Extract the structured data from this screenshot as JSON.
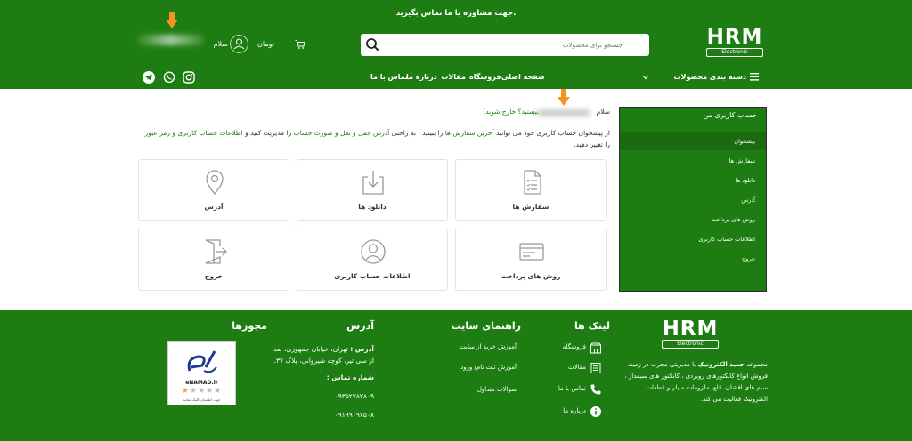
{
  "header": {
    "top_message": "جهت مشاوره با ما تماس بگیرید.",
    "logo_text": "HRM",
    "logo_sub": "Electronic",
    "search_placeholder": "جستجو برای محصولات",
    "cart_amount": "۰ تومان",
    "cart_count": "۰",
    "hello": "سلام"
  },
  "nav": {
    "categories": "دسته بندی محصولات",
    "items": [
      "صفحه اصلی",
      "فروشگاه",
      "مقالات",
      "درباره ما",
      "تماس با ما"
    ]
  },
  "account": {
    "welcome_prefix": "سلام",
    "welcome_suffix": "نیستید؟ خارج شوید)",
    "welcome_paren_open": "(",
    "intro_1": "از پیشخوان حساب کاربری خود می توانید",
    "intro_link_orders": "آخرین سفارش ها",
    "intro_2": "را ببینید ، به راحتی",
    "intro_link_address": "آدرس حمل و نقل و صورت حساب",
    "intro_3": "را مدیریت کنید و",
    "intro_link_account": "اطلاعات حساب کاربری و رمز عبور",
    "intro_4": "را تغییر دهید.",
    "cards": [
      "سفارش ها",
      "دانلود ها",
      "آدرس",
      "روش های پرداخت",
      "اطلاعات حساب کاربری",
      "خروج"
    ]
  },
  "sidebar": {
    "title": "حساب کاربری من",
    "items": [
      "پیشخوان",
      "سفارش ها",
      "دانلود ها",
      "آدرس",
      "روش های پرداخت",
      "اطلاعات حساب کاربری",
      "خروج"
    ]
  },
  "footer": {
    "about_prefix": "مجموعه",
    "about_brand": "حمید الکترونیک",
    "about_text": "با مدیریتی مجرب در زمینه فروش انواع کانکتورهای روبردی ، کانکتور های سیمدار ، سیم های افشان، قلع، ملزومات مایلر و قطعات الکترونیک فعالیت می کند.",
    "links_title": "لینک ها",
    "links": [
      "فروشگاه",
      "مقالات",
      "تماس با ما",
      "درباره ما"
    ],
    "guide_title": "راهنمای سایت",
    "guide": [
      "آموزش خرید از سایت",
      "آموزش ثبت نام/ ورود",
      "سوالات متداول"
    ],
    "address_title": "آدرس",
    "address_label": "آدرس :",
    "address_text": "تهران، خیابان جمهوری، بعد از سی تیر، کوچه شیروانی، پلاک ۳۷.",
    "phone_label": "شماره تماس :",
    "phone_1": "۰۹۳۵۲۷۸۲۸۰۹",
    "phone_2": "۰۹۱۹۹۰۹۷۵۰۸",
    "licenses_title": "مجوزها",
    "enamad_text": "eNAMAD.ir",
    "enamad_sub": "جهت اطمینان کلیک نمایید"
  },
  "colors": {
    "brand_green": "#1e7d12",
    "arrow_orange": "#f39323"
  }
}
